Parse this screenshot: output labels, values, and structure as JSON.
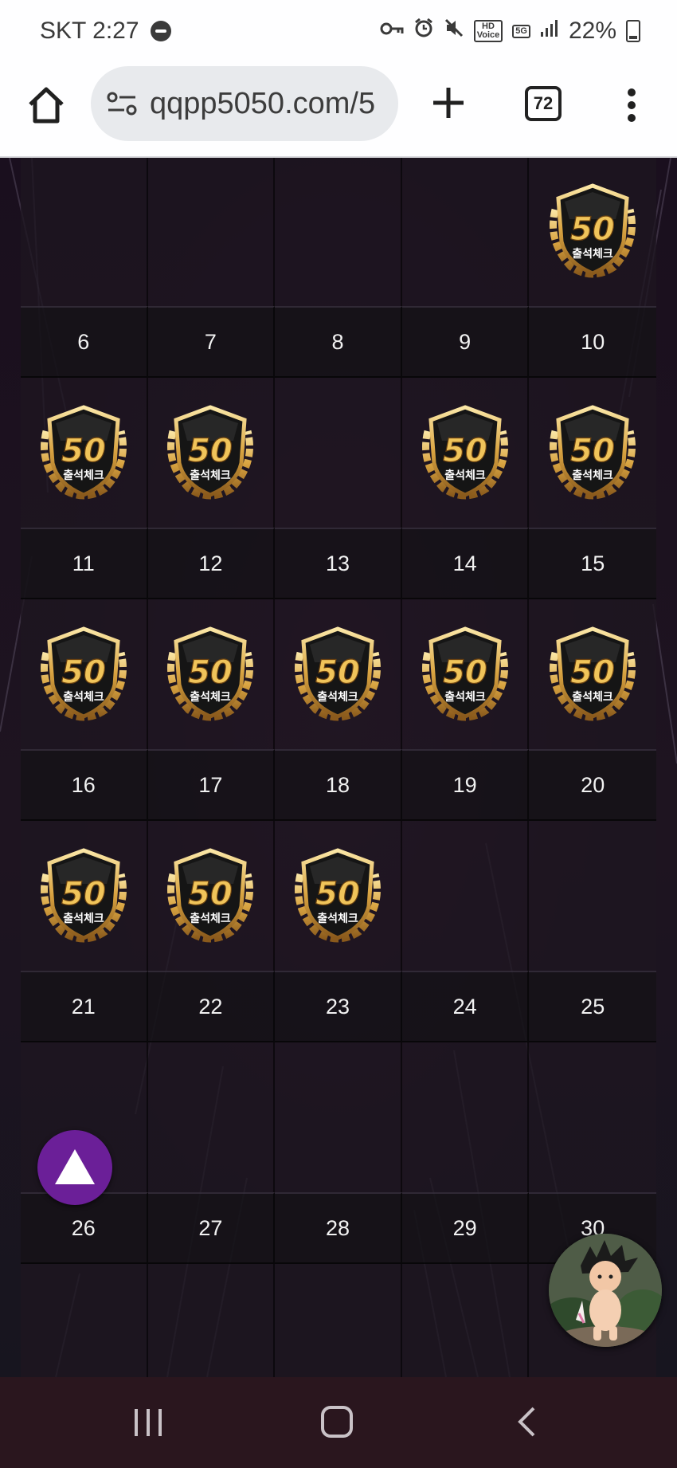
{
  "status_bar": {
    "carrier_time": "SKT 2:27",
    "battery_text": "22%",
    "icons": [
      "do-not-disturb-icon",
      "vpn-key-icon",
      "alarm-icon",
      "mute-icon",
      "hd-voice-icon",
      "5g-icon",
      "signal-icon",
      "battery-icon"
    ],
    "hd_voice_label": "HD\nVoice",
    "network_label": "5G"
  },
  "browser": {
    "url": "qqpp5050.com/5",
    "tab_count": "72",
    "icons": [
      "home-icon",
      "site-settings-icon",
      "new-tab-icon",
      "tab-switcher-icon",
      "more-menu-icon"
    ]
  },
  "calendar": {
    "badge_label": "출석체크",
    "badge_number": "50",
    "weeks": [
      {
        "badges": [
          false,
          false,
          false,
          false,
          true
        ],
        "days": [
          "6",
          "7",
          "8",
          "9",
          "10"
        ]
      },
      {
        "badges": [
          true,
          true,
          false,
          true,
          true
        ],
        "days": [
          "11",
          "12",
          "13",
          "14",
          "15"
        ]
      },
      {
        "badges": [
          true,
          true,
          true,
          true,
          true
        ],
        "days": [
          "16",
          "17",
          "18",
          "19",
          "20"
        ]
      },
      {
        "badges": [
          true,
          true,
          true,
          false,
          false
        ],
        "days": [
          "21",
          "22",
          "23",
          "24",
          "25"
        ]
      },
      {
        "badges": [
          false,
          false,
          false,
          false,
          false
        ],
        "days": [
          "26",
          "27",
          "28",
          "29",
          "30"
        ]
      },
      {
        "badges": [
          false,
          false,
          false,
          false,
          false
        ],
        "days": []
      }
    ]
  },
  "floating": {
    "scroll_top_icon": "triangle-up-icon",
    "chat_avatar_icon": "character-avatar-icon"
  },
  "navbar": {
    "icons": [
      "recent-apps-icon",
      "home-icon",
      "back-icon"
    ]
  },
  "colors": {
    "accent_purple": "#6b1f98",
    "badge_gold": "#d9a441",
    "page_bg": "#1a0f1e"
  }
}
